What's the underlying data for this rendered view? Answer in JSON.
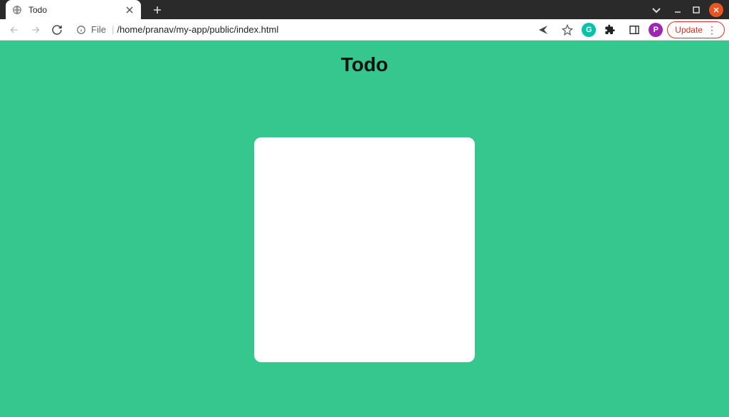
{
  "browser": {
    "tab": {
      "title": "Todo"
    },
    "address": {
      "file_label": "File",
      "path": "/home/pranav/my-app/public/index.html"
    },
    "update_button": "Update",
    "profile_initial": "P",
    "grammarly_initial": "G"
  },
  "page": {
    "title": "Todo"
  }
}
